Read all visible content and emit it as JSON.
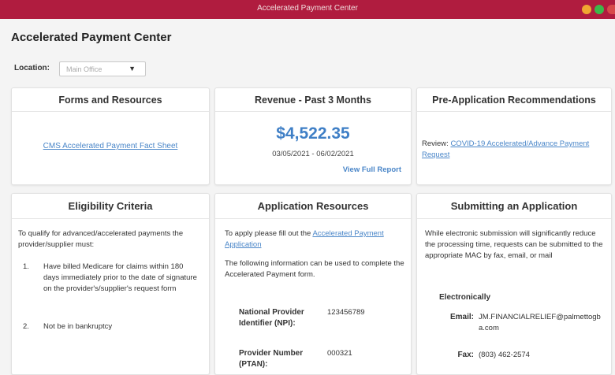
{
  "window": {
    "title": "Accelerated Payment Center"
  },
  "app": {
    "title": "Accelerated Payment Center"
  },
  "location": {
    "label": "Location:",
    "value": "Main Office"
  },
  "forms": {
    "heading": "Forms and Resources",
    "link": "CMS Accelerated Payment Fact Sheet"
  },
  "revenue": {
    "heading": "Revenue - Past 3 Months",
    "amount": "$4,522.35",
    "date_range": "03/05/2021 - 06/02/2021",
    "report_link": "View Full Report"
  },
  "pre_application": {
    "heading": "Pre-Application Recommendations",
    "review_label": "Review:",
    "link": "COVID-19 Accelerated/Advance Payment Request"
  },
  "eligibility": {
    "heading": "Eligibility Criteria",
    "intro": "To qualify for advanced/accelerated payments the provider/supplier must:",
    "items": [
      {
        "num": "1.",
        "text": "Have billed Medicare for claims within 180 days immediately prior to the date of signature on the provider's/supplier's request form"
      },
      {
        "num": "2.",
        "text": "Not be in bankruptcy"
      }
    ]
  },
  "application_resources": {
    "heading": "Application Resources",
    "intro_prefix": "To apply please fill out the ",
    "intro_link": "Accelerated Payment Application",
    "info_text": "The following information can be used to complete the Accelerated Payment form.",
    "fields": [
      {
        "label": "National Provider Identifier (NPI):",
        "value": "123456789"
      },
      {
        "label": "Provider Number (PTAN):",
        "value": "000321"
      }
    ]
  },
  "submitting": {
    "heading": "Submitting an Application",
    "intro": "While electronic submission will significantly reduce the processing time, requests can be submitted to the appropriate MAC by fax, email, or mail",
    "electronic_label": "Electronically",
    "email_label": "Email:",
    "email_value": "JM.FINANCIALRELIEF@palmettogba.com",
    "fax_label": "Fax:",
    "fax_value": "(803) 462-2574"
  },
  "colors": {
    "titlebar": "#b01c3f",
    "accent": "#3f7fc6",
    "link": "#4a86c8"
  }
}
